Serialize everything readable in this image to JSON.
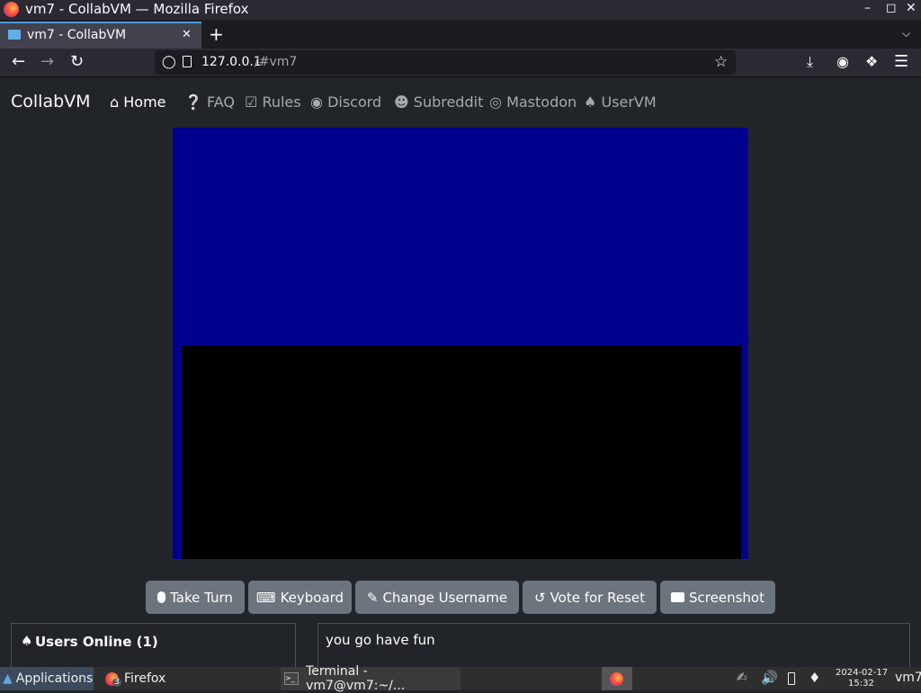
{
  "window": {
    "title": "vm7 - CollabVM — Mozilla Firefox",
    "controls": [
      "–",
      "◻",
      "✕"
    ]
  },
  "tab": {
    "title": "vm7 - CollabVM",
    "close": "✕",
    "new_tab": "+"
  },
  "urlbar": {
    "host": "127.0.0.1",
    "path": "/#vm7"
  },
  "site": {
    "brand": "CollabVM",
    "nav": [
      {
        "icon": "home-icon",
        "label": "Home"
      },
      {
        "icon": "question-icon",
        "label": "FAQ"
      },
      {
        "icon": "clipboard-check-icon",
        "label": "Rules"
      },
      {
        "icon": "discord-icon",
        "label": "Discord"
      },
      {
        "icon": "reddit-icon",
        "label": "Subreddit"
      },
      {
        "icon": "mastodon-icon",
        "label": "Mastodon"
      },
      {
        "icon": "user-icon",
        "label": "UserVM"
      }
    ],
    "buttons": {
      "take_turn": "Take Turn",
      "keyboard": "Keyboard",
      "change_username": "Change Username",
      "vote_reset": "Vote for Reset",
      "screenshot": "Screenshot"
    },
    "users_online": "Users Online (1)",
    "chat_message": "you go have fun"
  },
  "taskbar": {
    "applications": "Applications",
    "firefox": "Firefox",
    "firefox_badge": "3",
    "terminal": "Terminal - vm7@vm7:~/...",
    "date": "2024-02-17",
    "time": "15:32",
    "user": "vm7"
  },
  "colors": {
    "vm_screen": "#00008f",
    "accent": "#4a9ad8",
    "button": "#6c757d"
  }
}
